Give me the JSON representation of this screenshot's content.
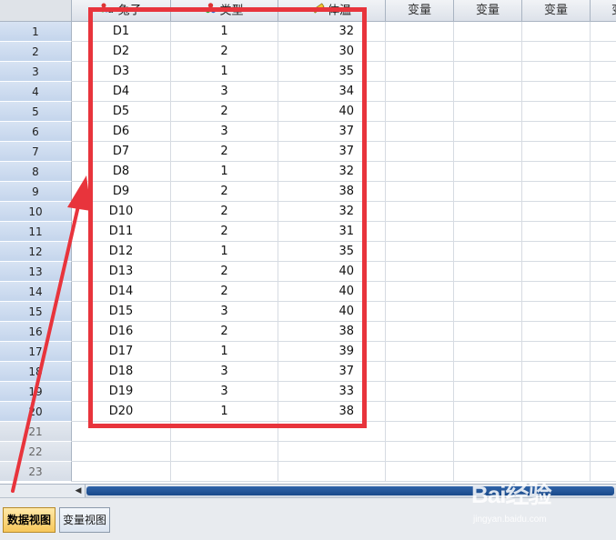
{
  "columns": [
    {
      "label": "兔子",
      "icon": "nominal-string-icon"
    },
    {
      "label": "类型",
      "icon": "nominal-icon"
    },
    {
      "label": "体温",
      "icon": "scale-ruler-icon"
    },
    {
      "label": "变量"
    },
    {
      "label": "变量"
    },
    {
      "label": "变量"
    },
    {
      "label": "变"
    }
  ],
  "rows": [
    {
      "num": "1",
      "rabbit": "D1",
      "type": "1",
      "temp": "32"
    },
    {
      "num": "2",
      "rabbit": "D2",
      "type": "2",
      "temp": "30"
    },
    {
      "num": "3",
      "rabbit": "D3",
      "type": "1",
      "temp": "35"
    },
    {
      "num": "4",
      "rabbit": "D4",
      "type": "3",
      "temp": "34"
    },
    {
      "num": "5",
      "rabbit": "D5",
      "type": "2",
      "temp": "40"
    },
    {
      "num": "6",
      "rabbit": "D6",
      "type": "3",
      "temp": "37"
    },
    {
      "num": "7",
      "rabbit": "D7",
      "type": "2",
      "temp": "37"
    },
    {
      "num": "8",
      "rabbit": "D8",
      "type": "1",
      "temp": "32"
    },
    {
      "num": "9",
      "rabbit": "D9",
      "type": "2",
      "temp": "38"
    },
    {
      "num": "10",
      "rabbit": "D10",
      "type": "2",
      "temp": "32"
    },
    {
      "num": "11",
      "rabbit": "D11",
      "type": "2",
      "temp": "31"
    },
    {
      "num": "12",
      "rabbit": "D12",
      "type": "1",
      "temp": "35"
    },
    {
      "num": "13",
      "rabbit": "D13",
      "type": "2",
      "temp": "40"
    },
    {
      "num": "14",
      "rabbit": "D14",
      "type": "2",
      "temp": "40"
    },
    {
      "num": "15",
      "rabbit": "D15",
      "type": "3",
      "temp": "40"
    },
    {
      "num": "16",
      "rabbit": "D16",
      "type": "2",
      "temp": "38"
    },
    {
      "num": "17",
      "rabbit": "D17",
      "type": "1",
      "temp": "39"
    },
    {
      "num": "18",
      "rabbit": "D18",
      "type": "3",
      "temp": "37"
    },
    {
      "num": "19",
      "rabbit": "D19",
      "type": "3",
      "temp": "33"
    },
    {
      "num": "20",
      "rabbit": "D20",
      "type": "1",
      "temp": "38"
    },
    {
      "num": "21",
      "rabbit": "",
      "type": "",
      "temp": ""
    },
    {
      "num": "22",
      "rabbit": "",
      "type": "",
      "temp": ""
    },
    {
      "num": "23",
      "rabbit": "",
      "type": "",
      "temp": ""
    }
  ],
  "tabs": {
    "data_view": "数据视图",
    "variable_view": "变量视图"
  },
  "annotation": {
    "highlight_color": "#e8343c"
  },
  "watermark": {
    "text": "Bai经验",
    "subtext": "jingyan.baidu.com"
  }
}
